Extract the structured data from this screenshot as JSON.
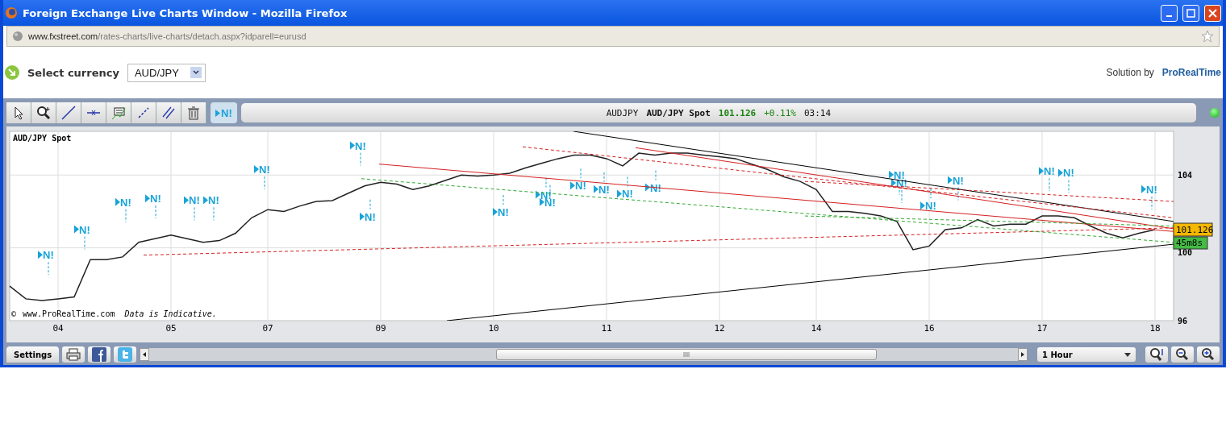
{
  "window": {
    "title": "Foreign Exchange Live Charts Window - Mozilla Firefox",
    "url_host": "www.fxstreet.com",
    "url_path": "/rates-charts/live-charts/detach.aspx?idparell=eurusd"
  },
  "header": {
    "label": "Select currency",
    "currency_select": {
      "value": "AUD/JPY"
    },
    "credit": "Solution by",
    "credit_brand": "ProRealTime"
  },
  "toolbar": {
    "tools": [
      {
        "kind": "pointer"
      },
      {
        "kind": "zoom"
      },
      {
        "kind": "trendline"
      },
      {
        "kind": "horizontal"
      },
      {
        "kind": "indicator"
      },
      {
        "kind": "channel"
      },
      {
        "kind": "parallel"
      },
      {
        "kind": "trash"
      }
    ],
    "news_button": {
      "label": "N!"
    }
  },
  "quote": {
    "symbol": "AUDJPY",
    "name": "AUD/JPY Spot",
    "price": "101.126",
    "change": "+0.11%",
    "time": "03:14",
    "live": true
  },
  "chart": {
    "title": "AUD/JPY Spot",
    "copyright": "©",
    "site": "www.ProRealTime.com",
    "disclaimer": "Data is Indicative.",
    "price_badge": "101.126",
    "timer_badge": "45m8s",
    "chart_data": {
      "type": "line",
      "ylim": [
        96,
        106.4
      ],
      "grid": true,
      "categories": [
        null,
        null,
        null,
        "04",
        null,
        null,
        null,
        null,
        null,
        null,
        "05",
        null,
        null,
        null,
        null,
        null,
        "07",
        null,
        null,
        null,
        null,
        null,
        null,
        "09",
        null,
        null,
        null,
        null,
        null,
        null,
        "10",
        null,
        null,
        null,
        null,
        null,
        null,
        "11",
        null,
        null,
        null,
        null,
        null,
        null,
        "12",
        null,
        null,
        null,
        null,
        null,
        "14",
        null,
        null,
        null,
        null,
        null,
        null,
        "16",
        null,
        null,
        null,
        null,
        null,
        null,
        "17",
        null,
        null,
        null,
        null,
        null,
        null,
        "18"
      ],
      "yticks": [
        96,
        100,
        104
      ],
      "series": [
        {
          "color": "#222222",
          "values": [
            97.9,
            97.2,
            97.1,
            97.2,
            97.3,
            99.35,
            99.35,
            99.5,
            100.3,
            100.5,
            100.7,
            100.5,
            100.3,
            100.4,
            100.8,
            101.65,
            102.1,
            102.0,
            102.3,
            102.55,
            102.6,
            103.0,
            103.4,
            103.6,
            103.5,
            103.2,
            103.4,
            103.7,
            104.0,
            103.95,
            104.0,
            104.1,
            104.4,
            104.65,
            104.9,
            105.1,
            105.1,
            104.9,
            104.5,
            105.2,
            105.1,
            105.2,
            105.2,
            105.1,
            105.0,
            104.9,
            104.6,
            104.3,
            103.9,
            103.65,
            103.2,
            102.0,
            102.0,
            101.9,
            101.75,
            101.45,
            99.9,
            100.1,
            101.0,
            101.1,
            101.55,
            101.2,
            101.3,
            101.3,
            101.75,
            101.75,
            101.65,
            101.2,
            100.8,
            100.55,
            100.8,
            101.0
          ]
        }
      ],
      "annotations": [
        "N!",
        "N!",
        "N!",
        "N!",
        "N!",
        "N!",
        "N!",
        "N!",
        "N!",
        "N!",
        "N!",
        "N!",
        "N!",
        "N!",
        "N!",
        "N!",
        "N!",
        "N!",
        "N!",
        "N!",
        "N!",
        "N!",
        "N!"
      ]
    }
  },
  "footer": {
    "settings": "Settings",
    "timeframe": "1 Hour"
  }
}
